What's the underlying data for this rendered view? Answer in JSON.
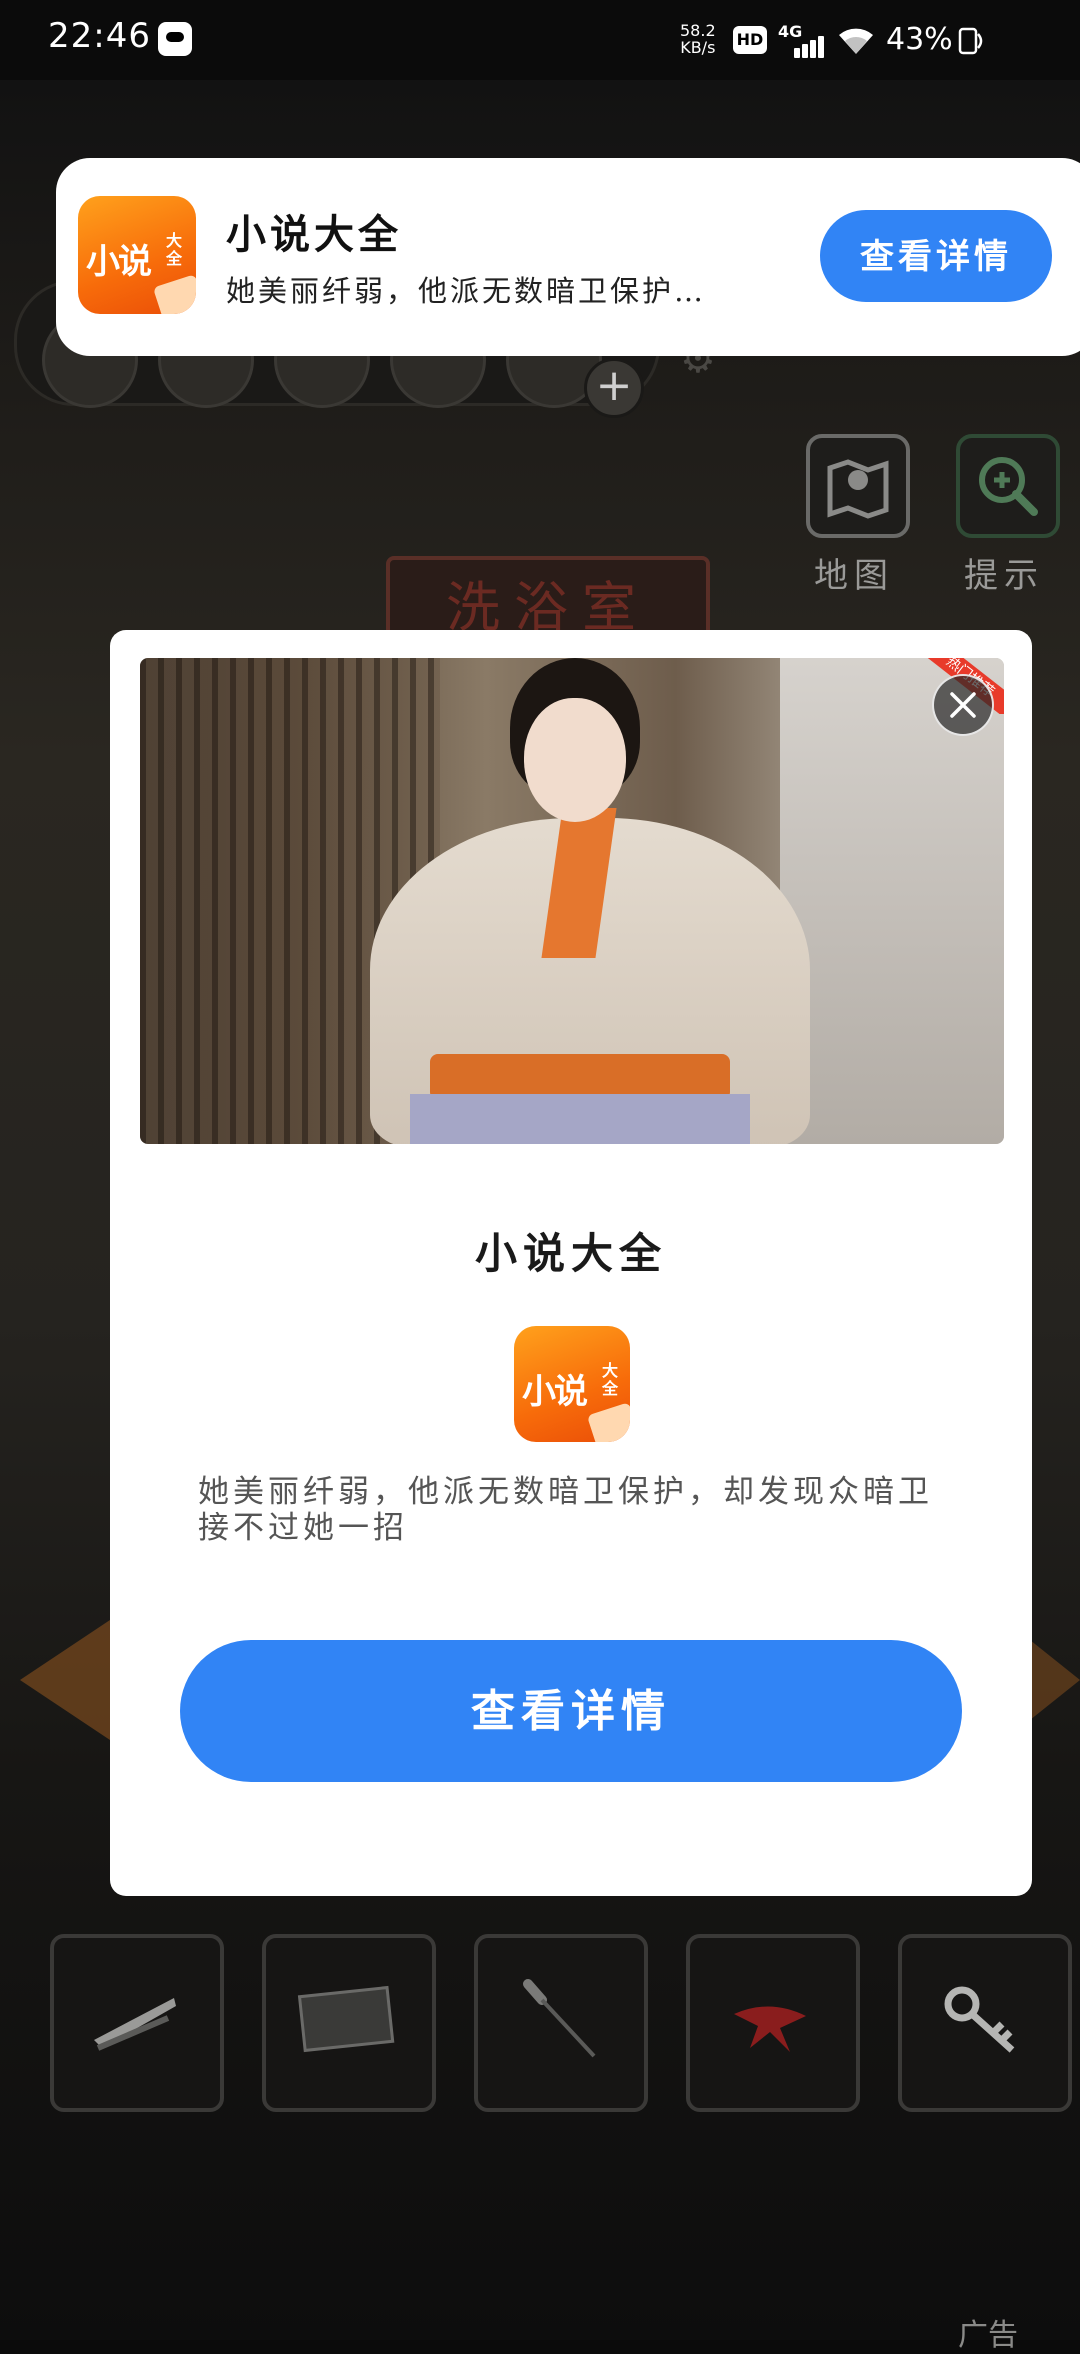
{
  "status_bar": {
    "time": "22:46",
    "net_speed_value": "58.2",
    "net_speed_unit": "KB/s",
    "hd_badge": "HD",
    "network_type": "4G",
    "battery": "43%",
    "icons": [
      "message-icon",
      "hd-icon",
      "signal-icon",
      "wifi-icon",
      "battery-icon"
    ]
  },
  "notification": {
    "app_icon_text": "小说",
    "app_icon_small": "大全",
    "title": "小说大全",
    "description": "她美丽纤弱，他派无数暗卫保护…",
    "button": "查看详情"
  },
  "game": {
    "room_sign": "洗浴室",
    "tools": [
      {
        "label": "地图",
        "icon": "map-icon"
      },
      {
        "label": "提示",
        "icon": "hint-search-icon"
      }
    ],
    "inventory": [
      "nail-clipper-icon",
      "photo-item-icon",
      "screwdriver-icon",
      "red-scarf-icon",
      "key-icon"
    ],
    "ad_corner": "广告"
  },
  "popup": {
    "badge": "热门推荐",
    "title": "小说大全",
    "app_icon_text": "小说",
    "app_icon_small": "大全",
    "description": "她美丽纤弱，他派无数暗卫保护，却发现众暗卫接不过她一招",
    "button": "查看详情"
  },
  "colors": {
    "accent_blue": "#3184f5",
    "icon_orange": "#f76b0a"
  }
}
